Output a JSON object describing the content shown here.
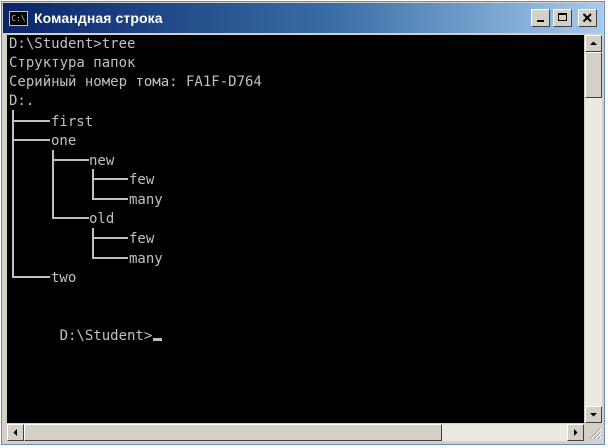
{
  "window": {
    "title": "Командная строка",
    "icon": "cmd-icon",
    "icon_glyph": "C:\\"
  },
  "controls": {
    "minimize_icon": "minimize-icon",
    "maximize_icon": "maximize-icon",
    "close_icon": "close-icon"
  },
  "console": {
    "header_lines": [
      "D:\\Student>tree",
      "Структура папок",
      "Серийный номер тома: FA1F-D764",
      "D:."
    ],
    "tree": {
      "lines": [
        "├───first",
        "├───one",
        "│   ├───new",
        "│   │   ├───few",
        "│   │   └───many",
        "│   └───old",
        "│       ├───few",
        "│       └───many",
        "└───two"
      ]
    },
    "blank_line": "",
    "prompt": "D:\\Student>",
    "text_color": "#c0c0c0",
    "background": "#000000"
  },
  "scrollbars": {
    "up_icon": "scroll-up-arrow-icon",
    "down_icon": "scroll-down-arrow-icon",
    "left_icon": "scroll-left-arrow-icon",
    "right_icon": "scroll-right-arrow-icon",
    "grip_icon": "resize-grip-icon"
  }
}
